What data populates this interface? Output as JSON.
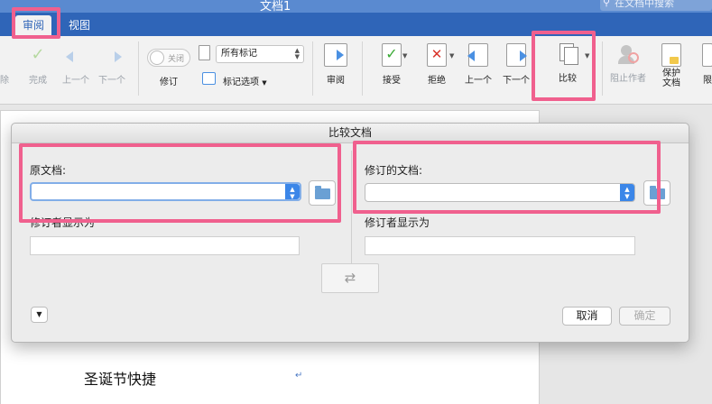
{
  "window": {
    "title": "文档1"
  },
  "search": {
    "placeholder": "在文档中搜索"
  },
  "tabs": [
    {
      "label": "审阅",
      "active": true
    },
    {
      "label": "视图",
      "active": false
    }
  ],
  "ribbon": {
    "delete_label": "除",
    "complete_label": "完成",
    "prev_comment_label": "上一个",
    "next_comment_label": "下一个",
    "track_toggle_state": "关闭",
    "track_label": "修订",
    "markup_select_value": "所有标记",
    "markup_options_label": "标记选项",
    "review_label": "审阅",
    "accept_label": "接受",
    "reject_label": "拒绝",
    "prev_change_label": "上一个",
    "next_change_label": "下一个",
    "compare_label": "比较",
    "block_authors_label": "阻止作者",
    "protect_doc_line1": "保护",
    "protect_doc_line2": "文档",
    "restrict_label": "限"
  },
  "dialog": {
    "title": "比较文档",
    "original_label": "原文档:",
    "original_value": "",
    "original_reviewer_label": "修订者显示为",
    "original_reviewer_value": "",
    "revised_label": "修订的文档:",
    "revised_value": "",
    "revised_reviewer_label": "修订者显示为",
    "revised_reviewer_value": "",
    "cancel_label": "取消",
    "ok_label": "确定"
  },
  "document": {
    "text": "圣诞节快捷"
  },
  "colors": {
    "accent": "#2f65b8",
    "highlight": "#f0608e",
    "button_blue": "#3b86e8"
  }
}
